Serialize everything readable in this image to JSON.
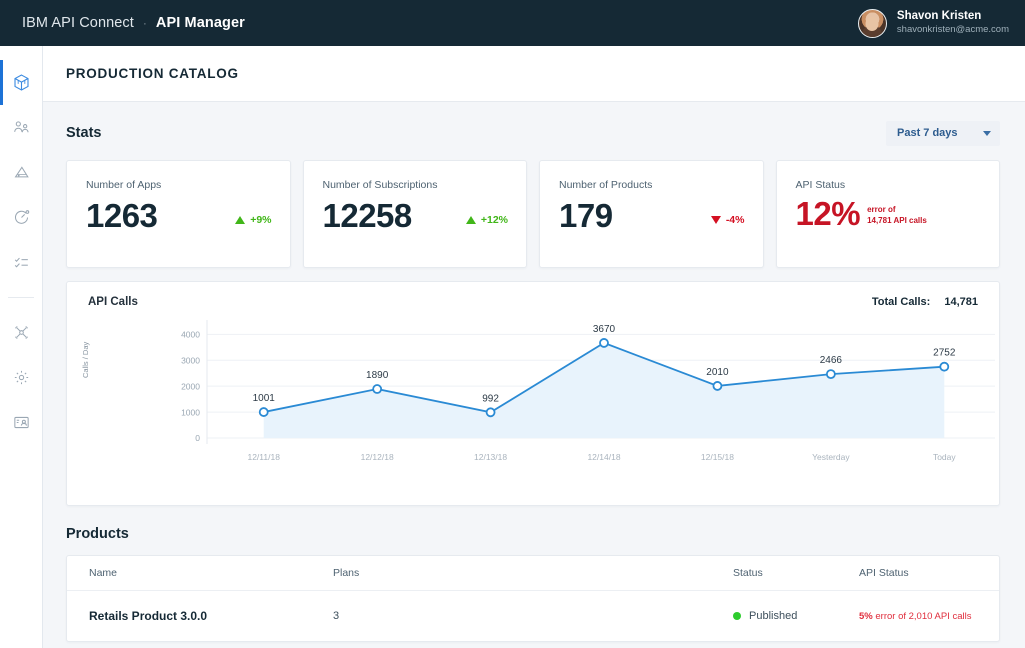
{
  "topbar": {
    "brand": "IBM API Connect",
    "separator": "·",
    "product": "API Manager",
    "user": {
      "name": "Shavon Kristen",
      "email": "shavonkristen@acme.com"
    }
  },
  "sidebar": {
    "items": [
      {
        "name": "sidebar-item-products",
        "icon": "cube-icon",
        "active": true
      },
      {
        "name": "sidebar-item-consumers",
        "icon": "people-icon",
        "active": false
      },
      {
        "name": "sidebar-item-analytics",
        "icon": "triangle-chart-icon",
        "active": false
      },
      {
        "name": "sidebar-item-monitor",
        "icon": "gauge-icon",
        "active": false
      },
      {
        "name": "sidebar-item-tasks",
        "icon": "checklist-icon",
        "active": false
      },
      {
        "name": "sidebar-item-gateways",
        "icon": "network-nodes-icon",
        "active": false
      },
      {
        "name": "sidebar-item-settings",
        "icon": "gear-icon",
        "active": false
      },
      {
        "name": "sidebar-item-members",
        "icon": "id-card-icon",
        "active": false
      }
    ]
  },
  "page": {
    "title": "PRODUCTION CATALOG"
  },
  "stats": {
    "heading": "Stats",
    "range_filter": {
      "value": "Past 7 days",
      "icon": "chevron-down-icon"
    },
    "cards": [
      {
        "label": "Number of Apps",
        "value": "1263",
        "delta": "+9%",
        "direction": "up"
      },
      {
        "label": "Number of Subscriptions",
        "value": "12258",
        "delta": "+12%",
        "direction": "up"
      },
      {
        "label": "Number of Products",
        "value": "179",
        "delta": "-4%",
        "direction": "down"
      }
    ],
    "api_status_card": {
      "label": "API Status",
      "percent": "12%",
      "note_line1": "error of",
      "note_line2": "14,781 API calls"
    }
  },
  "chart_card": {
    "title": "API Calls",
    "total_label": "Total Calls:",
    "total_value": "14,781"
  },
  "chart_data": {
    "type": "area",
    "title": "API Calls",
    "xlabel": "",
    "ylabel": "Calls / Day",
    "categories": [
      "12/11/18",
      "12/12/18",
      "12/13/18",
      "12/14/18",
      "12/15/18",
      "Yesterday",
      "Today"
    ],
    "values": [
      1001,
      1890,
      992,
      3670,
      2010,
      2466,
      2752
    ],
    "point_labels": [
      "1001",
      "1890",
      "992",
      "3670",
      "2010",
      "2466",
      "2752"
    ],
    "yticks": [
      0,
      1000,
      2000,
      3000,
      4000
    ],
    "ytick_labels": [
      "0",
      "1000",
      "2000",
      "3000",
      "4000"
    ],
    "ylim": [
      0,
      4400
    ],
    "grid": true,
    "legend": "none",
    "line_color": "#2a8ad4",
    "fill_color": "#e8f3fc",
    "point_fill": "#ffffff"
  },
  "products": {
    "heading": "Products",
    "columns": [
      "Name",
      "Plans",
      "Status",
      "API Status"
    ],
    "rows": [
      {
        "name": "Retails Product 3.0.0",
        "plans": "3",
        "status": "Published",
        "status_color": "#2ecc2e",
        "api_status_pct": "5%",
        "api_status_text": "error of 2,010 API calls"
      }
    ]
  },
  "colors": {
    "topbar_bg": "#152935",
    "page_bg": "#f4f6f9",
    "accent": "#1d72d6",
    "positive": "#41b619",
    "negative": "#d40f22",
    "error_red": "#c61425"
  }
}
